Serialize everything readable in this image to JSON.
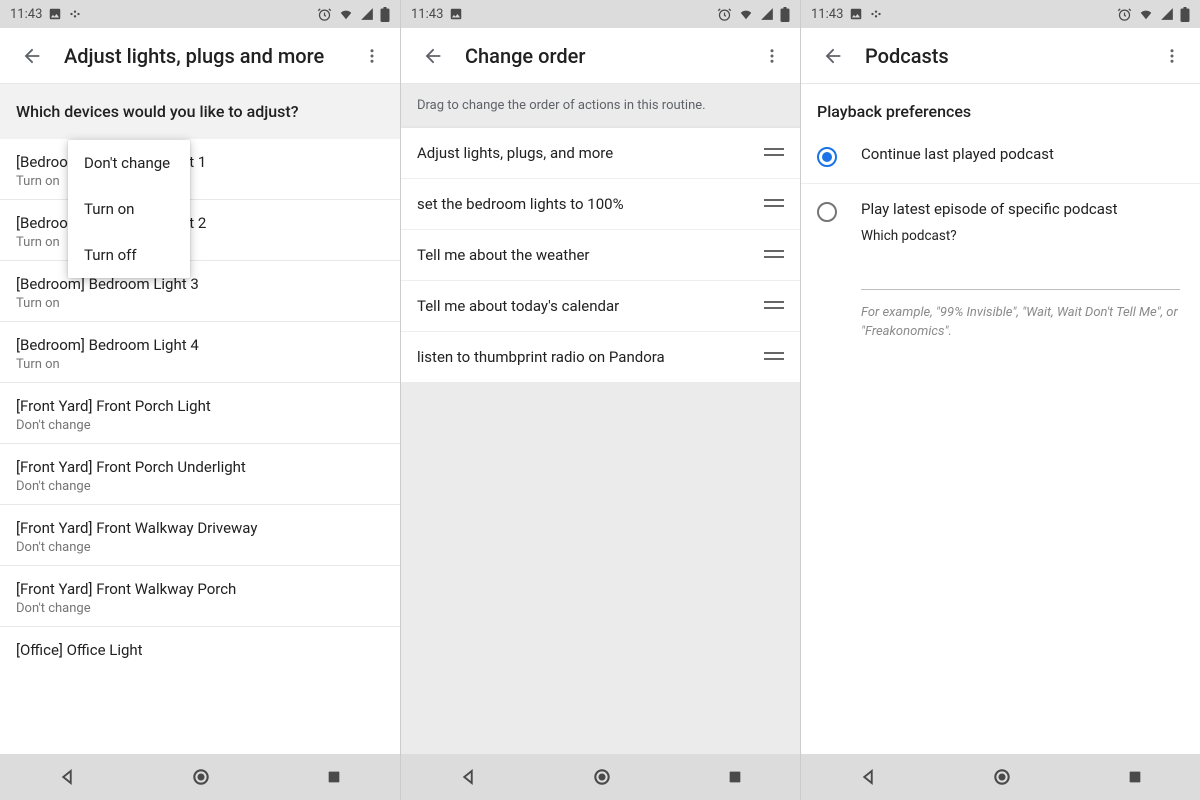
{
  "status": {
    "time": "11:43"
  },
  "panel1": {
    "title": "Adjust lights, plugs and more",
    "question": "Which devices would you like to adjust?",
    "popup": [
      "Don't change",
      "Turn on",
      "Turn off"
    ],
    "devices": [
      {
        "name": "[Bedroom] Bedroom Light 1",
        "name_obscured_pre": "[Bedroo",
        "name_obscured_post": "ght 1",
        "state": "Turn on"
      },
      {
        "name": "[Bedroom] Bedroom Light 2",
        "name_obscured_pre": "[Bedroo",
        "name_obscured_post": "ght 2",
        "state": "Turn on"
      },
      {
        "name": "[Bedroom] Bedroom Light 3",
        "state": "Turn on"
      },
      {
        "name": "[Bedroom] Bedroom Light 4",
        "state": "Turn on"
      },
      {
        "name": "[Front Yard] Front Porch Light",
        "state": "Don't change"
      },
      {
        "name": "[Front Yard] Front Porch Underlight",
        "state": "Don't change"
      },
      {
        "name": "[Front Yard] Front Walkway Driveway",
        "state": "Don't change"
      },
      {
        "name": "[Front Yard] Front Walkway Porch",
        "state": "Don't change"
      },
      {
        "name": "[Office] Office Light",
        "state": ""
      }
    ]
  },
  "panel2": {
    "title": "Change order",
    "instruction": "Drag to change the order of actions in this routine.",
    "actions": [
      "Adjust lights, plugs, and more",
      "set the bedroom lights to 100%",
      "Tell me about the weather",
      "Tell me about today's calendar",
      "listen to thumbprint radio on Pandora"
    ]
  },
  "panel3": {
    "title": "Podcasts",
    "section": "Playback preferences",
    "opt1": "Continue last played podcast",
    "opt2": "Play latest episode of specific podcast",
    "opt2_sub": "Which podcast?",
    "hint": "For example, \"99% Invisible\", \"Wait, Wait Don't Tell Me\", or \"Freakonomics\"."
  }
}
